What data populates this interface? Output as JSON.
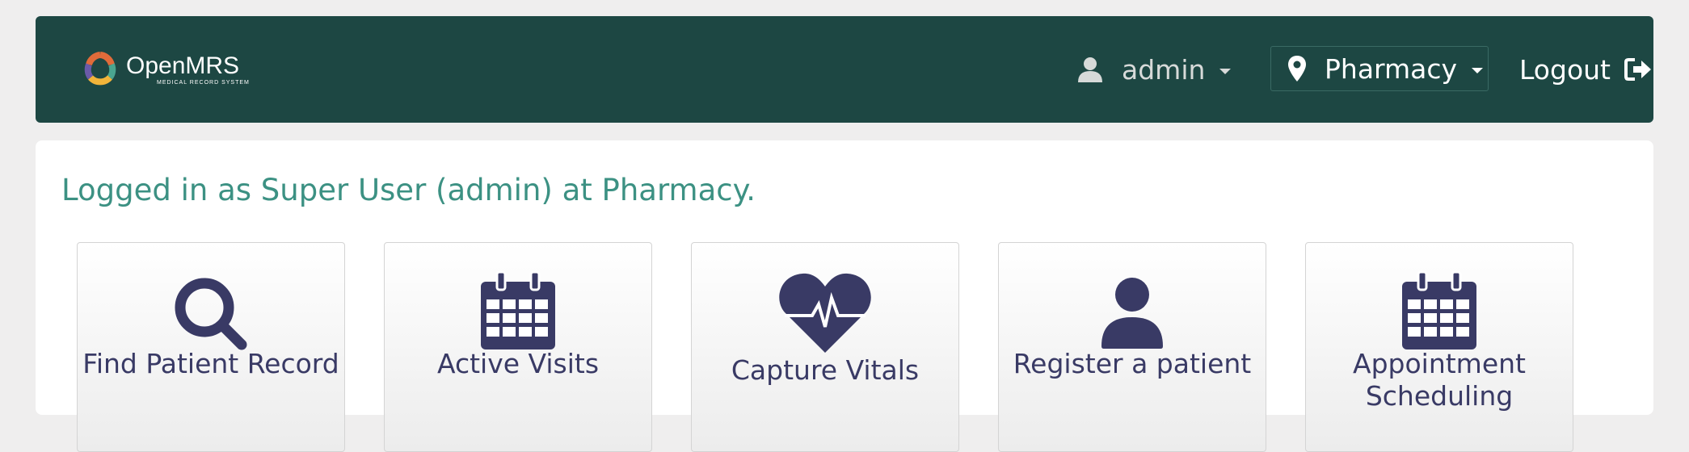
{
  "header": {
    "logo": {
      "title": "OpenMRS",
      "subtitle": "MEDICAL RECORD SYSTEM"
    },
    "user_menu": {
      "label": "admin",
      "icon": "user-icon"
    },
    "location_menu": {
      "label": "Pharmacy",
      "icon": "map-marker-icon"
    },
    "logout": {
      "label": "Logout",
      "icon": "sign-out-icon"
    }
  },
  "main": {
    "welcome_message": "Logged in as Super User (admin) at Pharmacy.",
    "apps": [
      {
        "label": "Find Patient Record",
        "icon": "search-icon"
      },
      {
        "label": "Active Visits",
        "icon": "calendar-icon"
      },
      {
        "label": "Capture Vitals",
        "icon": "heartbeat-icon"
      },
      {
        "label": "Register a patient",
        "icon": "user-icon"
      },
      {
        "label": "Appointment Scheduling",
        "icon": "calendar-icon"
      }
    ]
  },
  "colors": {
    "header_bg": "#1d4743",
    "welcome_text": "#3c9183",
    "tile_text": "#393a65",
    "page_bg": "#efeeee"
  }
}
